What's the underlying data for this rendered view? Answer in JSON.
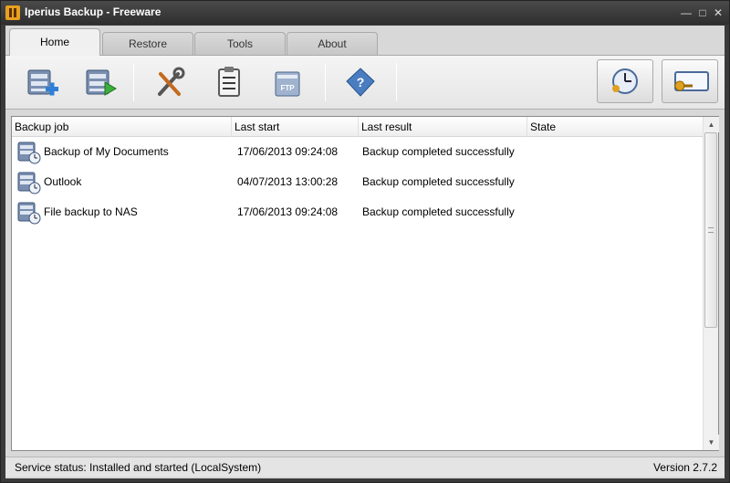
{
  "window": {
    "title": "Iperius Backup - Freeware"
  },
  "tabs": [
    {
      "label": "Home"
    },
    {
      "label": "Restore"
    },
    {
      "label": "Tools"
    },
    {
      "label": "About"
    }
  ],
  "toolbar": {
    "buttons": [
      "new-backup-icon",
      "run-backup-icon",
      "tools-icon",
      "clipboard-icon",
      "ftp-icon",
      "help-icon",
      "scheduler-icon",
      "license-key-icon"
    ],
    "ftp_label": "FTP"
  },
  "list": {
    "columns": [
      "Backup job",
      "Last start",
      "Last result",
      "State"
    ],
    "rows": [
      {
        "job": "Backup of My Documents",
        "last_start": "17/06/2013 09:24:08",
        "last_result": "Backup completed successfully",
        "state": ""
      },
      {
        "job": "Outlook",
        "last_start": "04/07/2013 13:00:28",
        "last_result": "Backup completed successfully",
        "state": ""
      },
      {
        "job": "File backup to NAS",
        "last_start": "17/06/2013 09:24:08",
        "last_result": "Backup completed successfully",
        "state": ""
      }
    ]
  },
  "status": {
    "service": "Service status: Installed and started (LocalSystem)",
    "version": "Version 2.7.2"
  }
}
